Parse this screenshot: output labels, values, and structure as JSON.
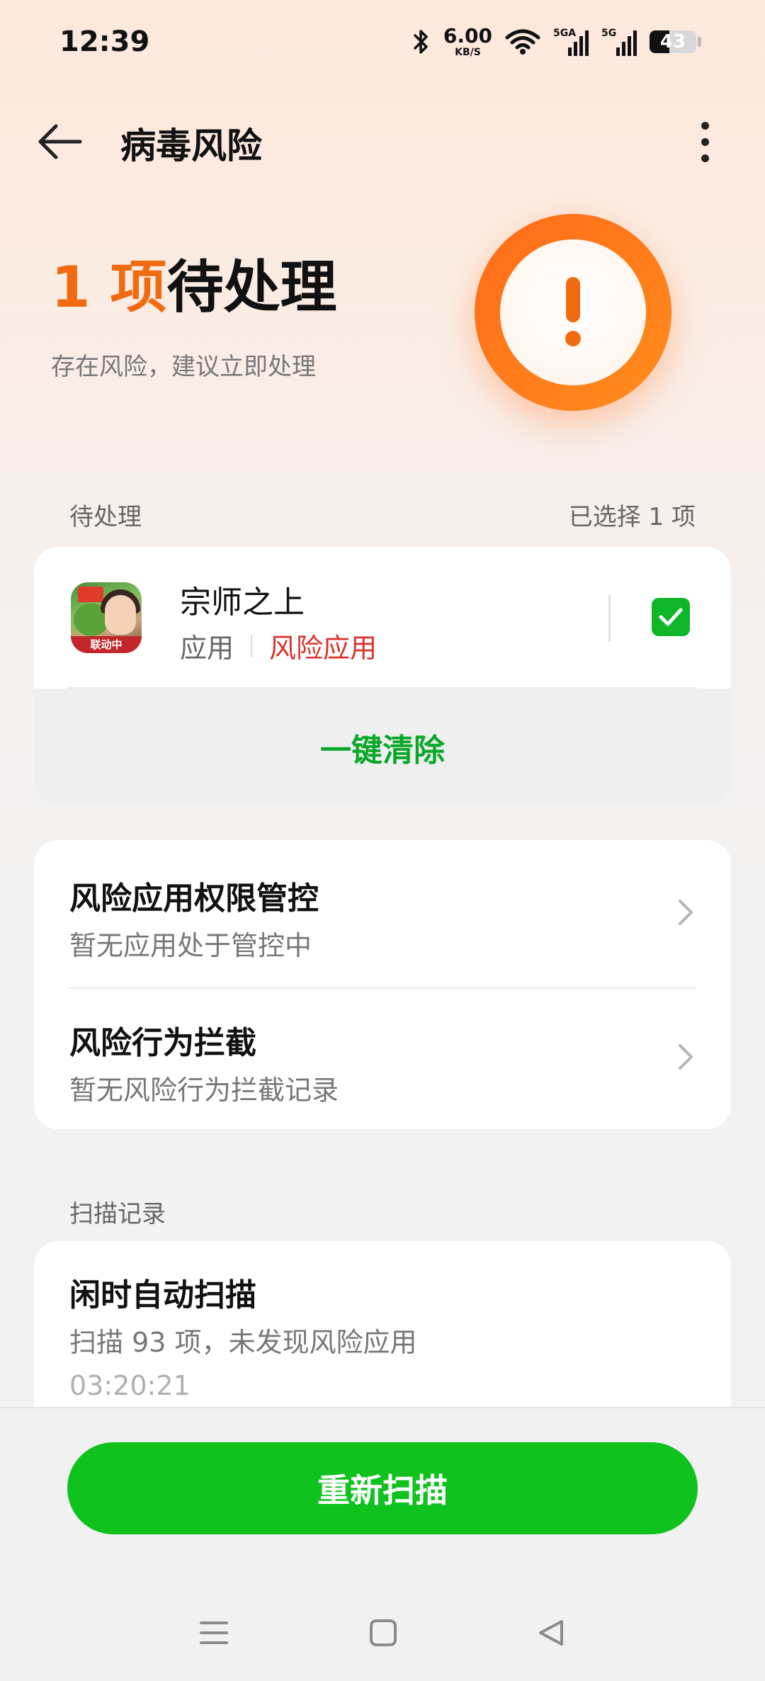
{
  "status_bar": {
    "time": "12:39",
    "net_speed_value": "6.00",
    "net_speed_unit": "KB/S",
    "signal1_label": "5GA",
    "signal2_label": "5G",
    "battery_level": "43"
  },
  "header": {
    "title": "病毒风险"
  },
  "hero": {
    "count": "1",
    "unit": " 项",
    "headline": "待处理",
    "subtitle": "存在风险，建议立即处理"
  },
  "pending": {
    "label": "待处理",
    "selected_text": "已选择 1 项",
    "app": {
      "name": "宗师之上",
      "type": "应用",
      "risk_label": "风险应用",
      "icon_badge": "联动中",
      "checked": true
    },
    "clear_label": "一键清除"
  },
  "controls": [
    {
      "title": "风险应用权限管控",
      "subtitle": "暂无应用处于管控中"
    },
    {
      "title": "风险行为拦截",
      "subtitle": "暂无风险行为拦截记录"
    }
  ],
  "scan_records": {
    "label": "扫描记录",
    "items": [
      {
        "title": "闲时自动扫描",
        "subtitle": "扫描 93 项，未发现风险应用",
        "time": "03:20:21"
      }
    ]
  },
  "rescan_label": "重新扫描",
  "colors": {
    "accent_orange": "#f06a10",
    "risk_red": "#d9332b",
    "primary_green": "#10c21e"
  }
}
